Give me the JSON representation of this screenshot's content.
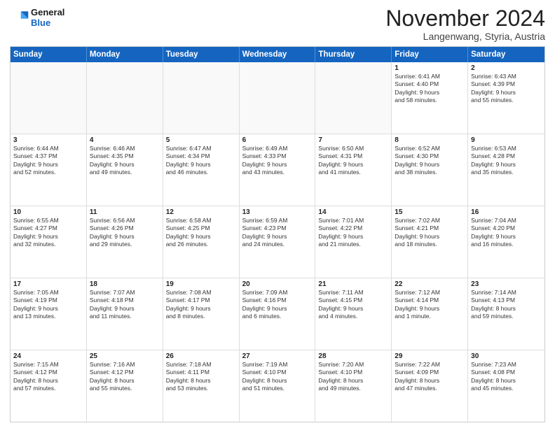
{
  "header": {
    "logo_line1": "General",
    "logo_line2": "Blue",
    "month_title": "November 2024",
    "location": "Langenwang, Styria, Austria"
  },
  "weekdays": [
    "Sunday",
    "Monday",
    "Tuesday",
    "Wednesday",
    "Thursday",
    "Friday",
    "Saturday"
  ],
  "rows": [
    [
      {
        "day": "",
        "text": ""
      },
      {
        "day": "",
        "text": ""
      },
      {
        "day": "",
        "text": ""
      },
      {
        "day": "",
        "text": ""
      },
      {
        "day": "",
        "text": ""
      },
      {
        "day": "1",
        "text": "Sunrise: 6:41 AM\nSunset: 4:40 PM\nDaylight: 9 hours\nand 58 minutes."
      },
      {
        "day": "2",
        "text": "Sunrise: 6:43 AM\nSunset: 4:39 PM\nDaylight: 9 hours\nand 55 minutes."
      }
    ],
    [
      {
        "day": "3",
        "text": "Sunrise: 6:44 AM\nSunset: 4:37 PM\nDaylight: 9 hours\nand 52 minutes."
      },
      {
        "day": "4",
        "text": "Sunrise: 6:46 AM\nSunset: 4:35 PM\nDaylight: 9 hours\nand 49 minutes."
      },
      {
        "day": "5",
        "text": "Sunrise: 6:47 AM\nSunset: 4:34 PM\nDaylight: 9 hours\nand 46 minutes."
      },
      {
        "day": "6",
        "text": "Sunrise: 6:49 AM\nSunset: 4:33 PM\nDaylight: 9 hours\nand 43 minutes."
      },
      {
        "day": "7",
        "text": "Sunrise: 6:50 AM\nSunset: 4:31 PM\nDaylight: 9 hours\nand 41 minutes."
      },
      {
        "day": "8",
        "text": "Sunrise: 6:52 AM\nSunset: 4:30 PM\nDaylight: 9 hours\nand 38 minutes."
      },
      {
        "day": "9",
        "text": "Sunrise: 6:53 AM\nSunset: 4:28 PM\nDaylight: 9 hours\nand 35 minutes."
      }
    ],
    [
      {
        "day": "10",
        "text": "Sunrise: 6:55 AM\nSunset: 4:27 PM\nDaylight: 9 hours\nand 32 minutes."
      },
      {
        "day": "11",
        "text": "Sunrise: 6:56 AM\nSunset: 4:26 PM\nDaylight: 9 hours\nand 29 minutes."
      },
      {
        "day": "12",
        "text": "Sunrise: 6:58 AM\nSunset: 4:25 PM\nDaylight: 9 hours\nand 26 minutes."
      },
      {
        "day": "13",
        "text": "Sunrise: 6:59 AM\nSunset: 4:23 PM\nDaylight: 9 hours\nand 24 minutes."
      },
      {
        "day": "14",
        "text": "Sunrise: 7:01 AM\nSunset: 4:22 PM\nDaylight: 9 hours\nand 21 minutes."
      },
      {
        "day": "15",
        "text": "Sunrise: 7:02 AM\nSunset: 4:21 PM\nDaylight: 9 hours\nand 18 minutes."
      },
      {
        "day": "16",
        "text": "Sunrise: 7:04 AM\nSunset: 4:20 PM\nDaylight: 9 hours\nand 16 minutes."
      }
    ],
    [
      {
        "day": "17",
        "text": "Sunrise: 7:05 AM\nSunset: 4:19 PM\nDaylight: 9 hours\nand 13 minutes."
      },
      {
        "day": "18",
        "text": "Sunrise: 7:07 AM\nSunset: 4:18 PM\nDaylight: 9 hours\nand 11 minutes."
      },
      {
        "day": "19",
        "text": "Sunrise: 7:08 AM\nSunset: 4:17 PM\nDaylight: 9 hours\nand 8 minutes."
      },
      {
        "day": "20",
        "text": "Sunrise: 7:09 AM\nSunset: 4:16 PM\nDaylight: 9 hours\nand 6 minutes."
      },
      {
        "day": "21",
        "text": "Sunrise: 7:11 AM\nSunset: 4:15 PM\nDaylight: 9 hours\nand 4 minutes."
      },
      {
        "day": "22",
        "text": "Sunrise: 7:12 AM\nSunset: 4:14 PM\nDaylight: 9 hours\nand 1 minute."
      },
      {
        "day": "23",
        "text": "Sunrise: 7:14 AM\nSunset: 4:13 PM\nDaylight: 8 hours\nand 59 minutes."
      }
    ],
    [
      {
        "day": "24",
        "text": "Sunrise: 7:15 AM\nSunset: 4:12 PM\nDaylight: 8 hours\nand 57 minutes."
      },
      {
        "day": "25",
        "text": "Sunrise: 7:16 AM\nSunset: 4:12 PM\nDaylight: 8 hours\nand 55 minutes."
      },
      {
        "day": "26",
        "text": "Sunrise: 7:18 AM\nSunset: 4:11 PM\nDaylight: 8 hours\nand 53 minutes."
      },
      {
        "day": "27",
        "text": "Sunrise: 7:19 AM\nSunset: 4:10 PM\nDaylight: 8 hours\nand 51 minutes."
      },
      {
        "day": "28",
        "text": "Sunrise: 7:20 AM\nSunset: 4:10 PM\nDaylight: 8 hours\nand 49 minutes."
      },
      {
        "day": "29",
        "text": "Sunrise: 7:22 AM\nSunset: 4:09 PM\nDaylight: 8 hours\nand 47 minutes."
      },
      {
        "day": "30",
        "text": "Sunrise: 7:23 AM\nSunset: 4:08 PM\nDaylight: 8 hours\nand 45 minutes."
      }
    ]
  ]
}
